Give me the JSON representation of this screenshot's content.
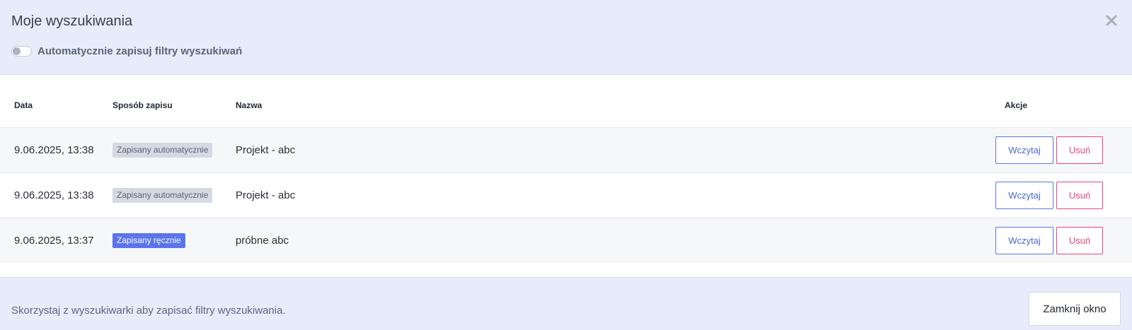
{
  "modal": {
    "title": "Moje wyszukiwania",
    "auto_save_toggle": {
      "label": "Automatycznie zapisuj filtry wyszukiwań",
      "enabled": false
    }
  },
  "table": {
    "headers": {
      "date": "Data",
      "method": "Sposób zapisu",
      "name": "Nazwa",
      "actions": "Akcje"
    },
    "rows": [
      {
        "date": "9.06.2025, 13:38",
        "method": "Zapisany automatycznie",
        "method_type": "auto",
        "name": "Projekt - abc",
        "load_label": "Wczytaj",
        "delete_label": "Usuń"
      },
      {
        "date": "9.06.2025, 13:38",
        "method": "Zapisany automatycznie",
        "method_type": "auto",
        "name": "Projekt - abc",
        "load_label": "Wczytaj",
        "delete_label": "Usuń"
      },
      {
        "date": "9.06.2025, 13:37",
        "method": "Zapisany ręcznie",
        "method_type": "manual",
        "name": "próbne abc",
        "load_label": "Wczytaj",
        "delete_label": "Usuń"
      }
    ]
  },
  "footer": {
    "hint": "Skorzystaj z wyszukiwarki aby zapisać filtry wyszukiwania.",
    "close_label": "Zamknij okno"
  },
  "colors": {
    "header_bg": "#e8ebf9",
    "primary": "#5a74ee",
    "danger": "#e8457c",
    "auto_badge": "#d5d9e1"
  },
  "icons": {
    "close": "close-icon"
  }
}
